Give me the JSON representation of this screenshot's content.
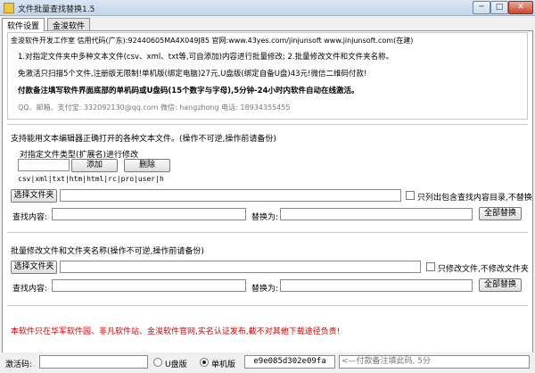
{
  "window": {
    "title": "文件批量查找替换1.5",
    "min": "─",
    "max": "□",
    "close": "✕"
  },
  "tabs": [
    "软件设置",
    "金浚软件"
  ],
  "info": {
    "company": "金浚软件开发工作室  信用代码(广东):92440605MA4X049J85 官网:www.43yes.com/jinjunsoft  www.jinjunsoft.com(在建)",
    "line1": "1.对指定文件夹中多种文本文件(csv、xml、txt等,可自添加)内容进行批量修改; 2.批量修改文件和文件夹名称。",
    "line2": "免激活只扫描5个文件,注册版无限制!单机版(绑定电脑)27元,U盘版(绑定自备U盘)43元!微信二维码付款!",
    "line3": "付款备注填写软件界面底部的单机码或U盘码(15个数字与字母),5分钟-24小时内软件自动在线激活。",
    "contact": "QQ、邮箱、支付宝: 332092130@qq.com      微信: hangzhong      电话: 18934355455"
  },
  "content_section": {
    "heading": "支持能用文本编辑器正确打开的各种文本文件。(操作不可逆,操作前请备份)",
    "ext_label": "对指定文件类型(扩展名)进行修改",
    "ext_input": "",
    "add_btn": "添加",
    "delete_btn": "删除",
    "ext_list": "csv|xml|txt|htm|html|rc|pro|user|h",
    "choose_folder_btn": "选择文件夹",
    "folder_path": "",
    "only_list_label": "只列出包含查找内容目录,不替换",
    "find_label": "查找内容:",
    "find_value": "",
    "replace_label": "替换为:",
    "replace_value": "",
    "replace_all_btn": "全部替换"
  },
  "name_section": {
    "heading": "批量修改文件和文件夹名称(操作不可逆,操作前请备份)",
    "choose_folder_btn": "选择文件夹",
    "folder_path": "",
    "only_file_label": "只修改文件,不修改文件夹",
    "find_label": "查找内容:",
    "find_value": "",
    "replace_label": "替换为:",
    "replace_value": "",
    "replace_all_btn": "全部替换"
  },
  "notice": "本软件只在华军软件园、非凡软件站、金浚软件官网,实名认证发布,截不对其他下载途径负责!",
  "status": {
    "activation_label": "激活码:",
    "activation_value": "",
    "usb_label": "U盘版",
    "standalone_label": "单机版",
    "machine_code": "e9e085d302e09fa",
    "hint": "<—付款备注填此码, 5分"
  }
}
